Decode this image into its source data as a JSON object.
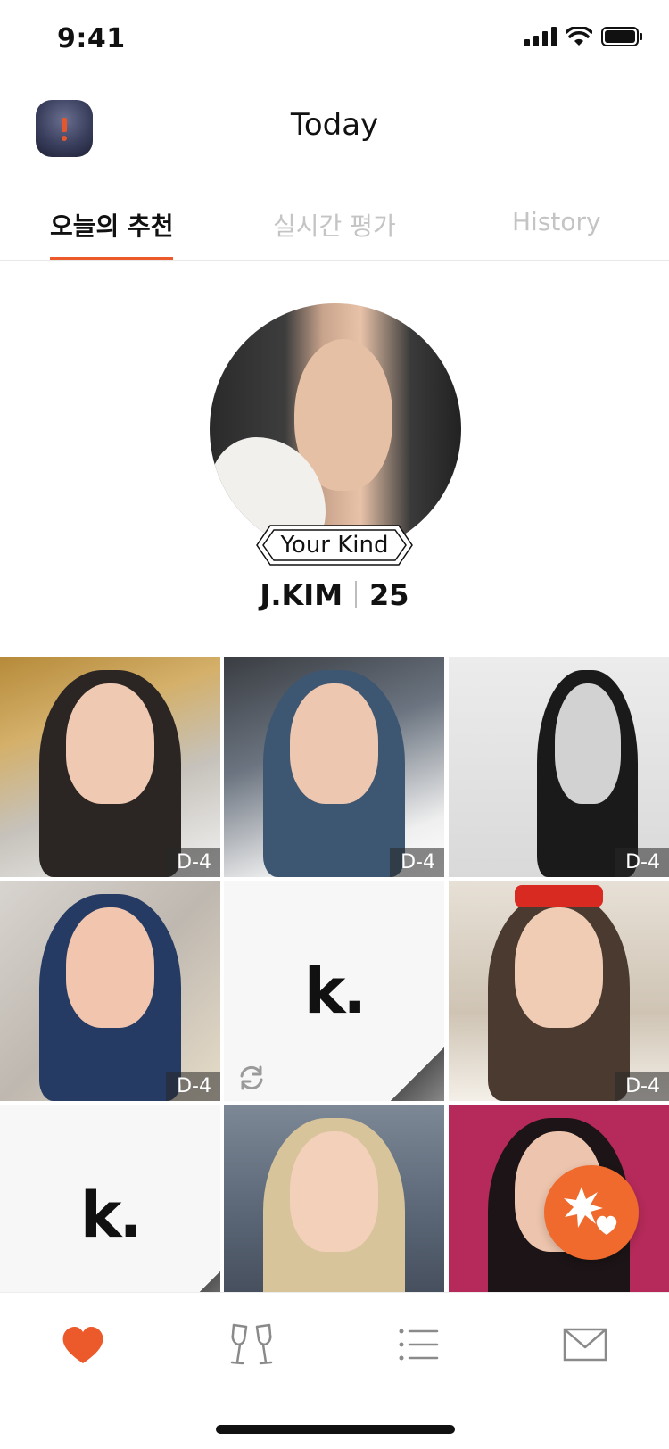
{
  "status_bar": {
    "time": "9:41"
  },
  "header": {
    "title": "Today"
  },
  "tabs": [
    {
      "label": "오늘의 추천",
      "active": true
    },
    {
      "label": "실시간 평가",
      "active": false
    },
    {
      "label": "History",
      "active": false
    }
  ],
  "featured": {
    "badge": "Your Kind",
    "name": "J.KIM",
    "age": "25"
  },
  "grid": [
    {
      "kind": "photo",
      "tag": "D-4"
    },
    {
      "kind": "photo",
      "tag": "D-4"
    },
    {
      "kind": "photo",
      "tag": "D-4"
    },
    {
      "kind": "photo",
      "tag": "D-4"
    },
    {
      "kind": "placeholder",
      "logo": "k."
    },
    {
      "kind": "photo",
      "tag": "D-4"
    },
    {
      "kind": "placeholder",
      "logo": "k."
    },
    {
      "kind": "photo"
    },
    {
      "kind": "photo"
    }
  ],
  "colors": {
    "accent": "#ec5a2b",
    "inactive_tab": "#c4c4c4",
    "nav_icon": "#8a8a8a"
  },
  "bottom_nav": [
    {
      "icon": "heart-icon",
      "active": true
    },
    {
      "icon": "cheers-glasses-icon",
      "active": false
    },
    {
      "icon": "list-icon",
      "active": false
    },
    {
      "icon": "mail-icon",
      "active": false
    }
  ]
}
